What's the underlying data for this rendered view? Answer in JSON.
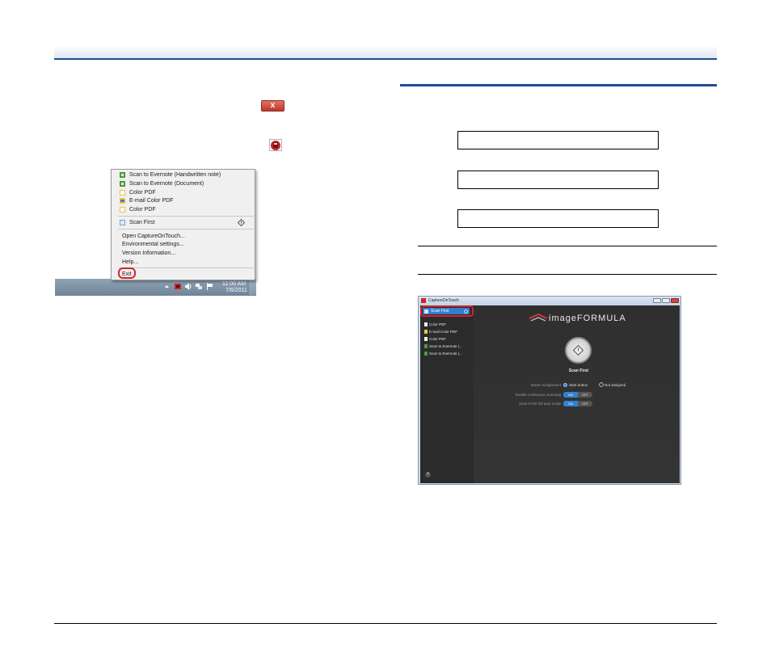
{
  "palette": {
    "accent_blue": "#1d4e8f",
    "highlight_red": "#d92128",
    "app_select_blue": "#2f7fd0"
  },
  "inline_icons": {
    "close_button": "close-button-icon",
    "tray": "captureontouch-tray-icon"
  },
  "close_button_glyph": "x",
  "context_menu": {
    "items": [
      {
        "label": "Scan to Evernote (Handwritten note)",
        "icon": "evernote-icon"
      },
      {
        "label": "Scan to Evernote (Document)",
        "icon": "evernote-icon"
      },
      {
        "label": "Color PDF",
        "icon": "pdf-icon"
      },
      {
        "label": "E-mail Color PDF",
        "icon": "email-pdf-icon"
      },
      {
        "label": "Color PDF",
        "icon": "pdf-icon"
      }
    ],
    "scan_first": {
      "label": "Scan First",
      "icon": "scan-first-icon",
      "shortcut_icon": "start-button-icon"
    },
    "commands": [
      "Open CaptureOnTouch...",
      "Environmental settings...",
      "Version Information...",
      "Help..."
    ],
    "exit_label": "Exit"
  },
  "taskbar": {
    "time": "11:00 AM",
    "date": "7/6/2011"
  },
  "app_window": {
    "title": "CaptureOnTouch",
    "sidebar": {
      "selected": "Scan First",
      "items": [
        "Color PDF",
        "E-mail Color PDF",
        "Color PDF",
        "Scan to Evernote (...",
        "Scan to Evernote (..."
      ],
      "add_glyph": "+"
    },
    "logo": "imageFORMULA",
    "job_name": "Scan First",
    "button_assignment": {
      "label": "Button assignment",
      "start": "Start button",
      "not_assigned": "Not assigned"
    },
    "continuous": {
      "label": "Enable continuous scanning",
      "on": "ON",
      "off": "OFF"
    },
    "full_auto": {
      "label": "Scan in the full auto mode",
      "on": "ON",
      "off": "OFF"
    }
  }
}
